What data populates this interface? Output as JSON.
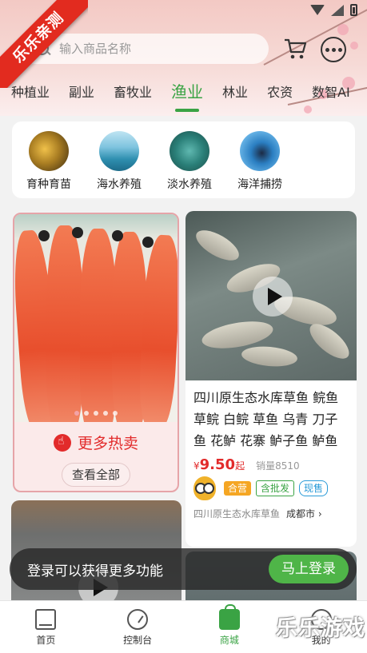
{
  "app": {
    "ribbon_label": "乐乐亲测"
  },
  "search": {
    "placeholder": "输入商品名称"
  },
  "icons": {
    "cart": "cart-icon",
    "more": "more-icon",
    "search": "search-icon"
  },
  "tabs": [
    {
      "label": "种植业",
      "active": false
    },
    {
      "label": "副业",
      "active": false
    },
    {
      "label": "畜牧业",
      "active": false
    },
    {
      "label": "渔业",
      "active": true
    },
    {
      "label": "林业",
      "active": false
    },
    {
      "label": "农资",
      "active": false
    },
    {
      "label": "数智AI",
      "active": false
    }
  ],
  "categories": [
    {
      "label": "育种育苗"
    },
    {
      "label": "海水养殖"
    },
    {
      "label": "淡水养殖"
    },
    {
      "label": "海洋捕捞"
    }
  ],
  "hot_card": {
    "title": "更多热卖",
    "view_all": "查看全部"
  },
  "product": {
    "title": "四川原生态水库草鱼 鲩鱼 草鲩 白鲩 草鱼 乌青 刀子鱼 花鲈 花寨 鲈子鱼 鲈鱼",
    "price_symbol": "¥",
    "price": "9.50",
    "price_suffix": "起",
    "sales": "销量8510",
    "tags": [
      "合营",
      "含批发",
      "现售"
    ],
    "shop": "四川原生态水库草鱼",
    "city": "成都市 ›"
  },
  "login_banner": {
    "text": "登录可以获得更多功能",
    "button": "马上登录"
  },
  "bottom_nav": [
    {
      "label": "首页",
      "icon": "home-icon",
      "active": false
    },
    {
      "label": "控制台",
      "icon": "dashboard-icon",
      "active": false
    },
    {
      "label": "商城",
      "icon": "shopping-bag-icon",
      "active": true
    },
    {
      "label": "我的",
      "icon": "user-icon",
      "active": false
    }
  ],
  "watermark": "乐乐游戏",
  "colors": {
    "accent_green": "#3aa344",
    "price_red": "#e22b2b",
    "ribbon_red": "#e22b1f",
    "login_green": "#4fb548"
  }
}
